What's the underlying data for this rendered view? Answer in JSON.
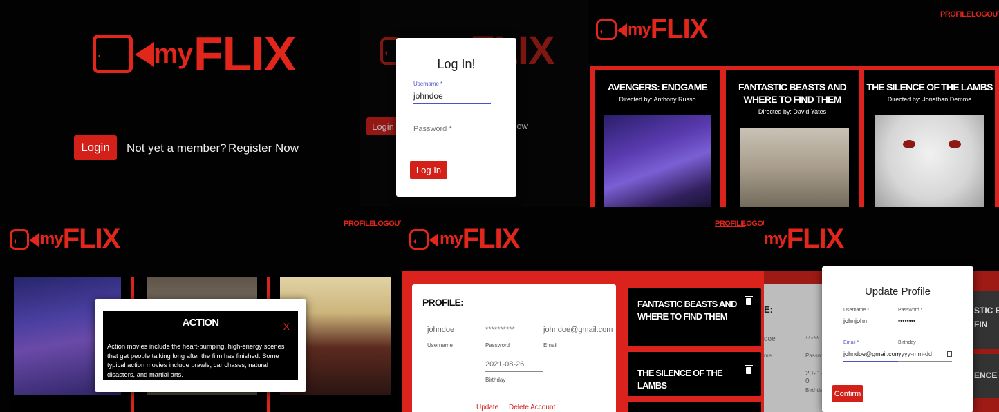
{
  "brand": {
    "my": "my",
    "flix": "FLIX",
    "accent": "#e1261c"
  },
  "welcome": {
    "login_button": "Login",
    "not_member": "Not yet a member?",
    "register": "Register Now"
  },
  "login_dialog": {
    "title": "Log In!",
    "username_label": "Username *",
    "username_value": "johndoe",
    "password_placeholder": "Password *",
    "submit": "Log In",
    "bg_login": "Login",
    "bg_register": "r Now"
  },
  "nav": {
    "profile": "PROFILE",
    "logout": "LOGOUT"
  },
  "movies": [
    {
      "title": "AVENGERS: ENDGAME",
      "director": "Directed by: Anthony Russo"
    },
    {
      "title": "FANTASTIC BEASTS AND WHERE TO FIND THEM",
      "director": "Directed by: David Yates"
    },
    {
      "title": "THE SILENCE OF THE LAMBS",
      "director": "Directed by: Jonathan Demme"
    }
  ],
  "genre_dialog": {
    "title": "ACTION",
    "close": "X",
    "description": "Action movies include the heart-pumping, high-energy scenes that get people talking long after the film has finished. Some typical action movies include brawls, car chases, natural disasters, and martial arts."
  },
  "profile": {
    "heading": "PROFILE:",
    "username": "johndoe",
    "username_label": "Username",
    "password": "**********",
    "password_label": "Password",
    "email": "johndoe@gmail.com",
    "email_label": "Email",
    "birthday": "2021-08-26",
    "birthday_label": "Birthday",
    "update": "Update",
    "delete": "Delete Account",
    "favorites": [
      {
        "title": "FANTASTIC BEASTS AND WHERE TO FIND THEM"
      },
      {
        "title": "THE SILENCE OF THE LAMBS"
      }
    ]
  },
  "update_dialog": {
    "title": "Update Profile",
    "username_label": "Username *",
    "username_value": "johnjohn",
    "password_label": "Password *",
    "password_value": "••••••••",
    "email_label": "Email *",
    "email_value": "johndoe@gmail.com",
    "birthday_label": "Birthday",
    "birthday_placeholder": "yyyy-mm-dd",
    "confirm": "Confirm",
    "bg_text_1": "E:",
    "bg_text_2": "doe",
    "bg_text_3": "me",
    "bg_text_4": "*****",
    "bg_text_5": "Password",
    "bg_text_6": "2021-0",
    "bg_text_7": "Birthday",
    "bg_right_1": "STIC B",
    "bg_right_2": "FIN",
    "bg_right_3": "ENCE O"
  }
}
